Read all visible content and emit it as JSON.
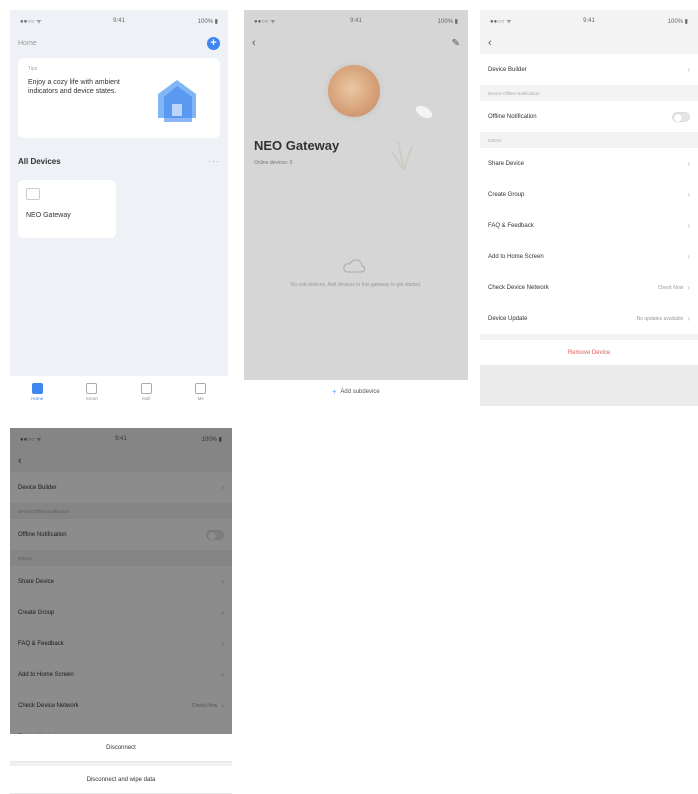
{
  "screen1": {
    "home_name": "Home",
    "weather_label": "Tips",
    "weather_tip": "Enjoy a cozy life with ambient indicators and device states.",
    "section_title": "All Devices",
    "more": "···",
    "device_name": "NEO Gateway",
    "tabs": [
      {
        "label": "Home",
        "icon": "home-icon"
      },
      {
        "label": "Smart",
        "icon": "smart-icon"
      },
      {
        "label": "Mall",
        "icon": "mall-icon"
      },
      {
        "label": "Me",
        "icon": "me-icon"
      }
    ]
  },
  "screen2": {
    "device_title": "NEO Gateway",
    "device_sub": "Online devices: 0",
    "empty_text": "No sub-devices. Add devices to this gateway to get started.",
    "add_label": "Add subdevice"
  },
  "settings": {
    "rows": {
      "device_builder": "Device Builder",
      "offline_group": "Device Offline Notification",
      "offline_notification": "Offline Notification",
      "others": "Others",
      "share_device": "Share Device",
      "create_group": "Create Group",
      "faq": "FAQ & Feedback",
      "add_home_screen": "Add to Home Screen",
      "check_network": "Check Device Network",
      "check_network_value": "Check Now",
      "device_update": "Device Update",
      "device_update_value": "No updates available"
    },
    "remove_label": "Remove Device"
  },
  "sheet": {
    "items": [
      "Disconnect",
      "Disconnect and wipe data"
    ]
  },
  "status": {
    "carrier": "●●○○ ᯤ",
    "time": "9:41",
    "battery": "100% ▮"
  }
}
